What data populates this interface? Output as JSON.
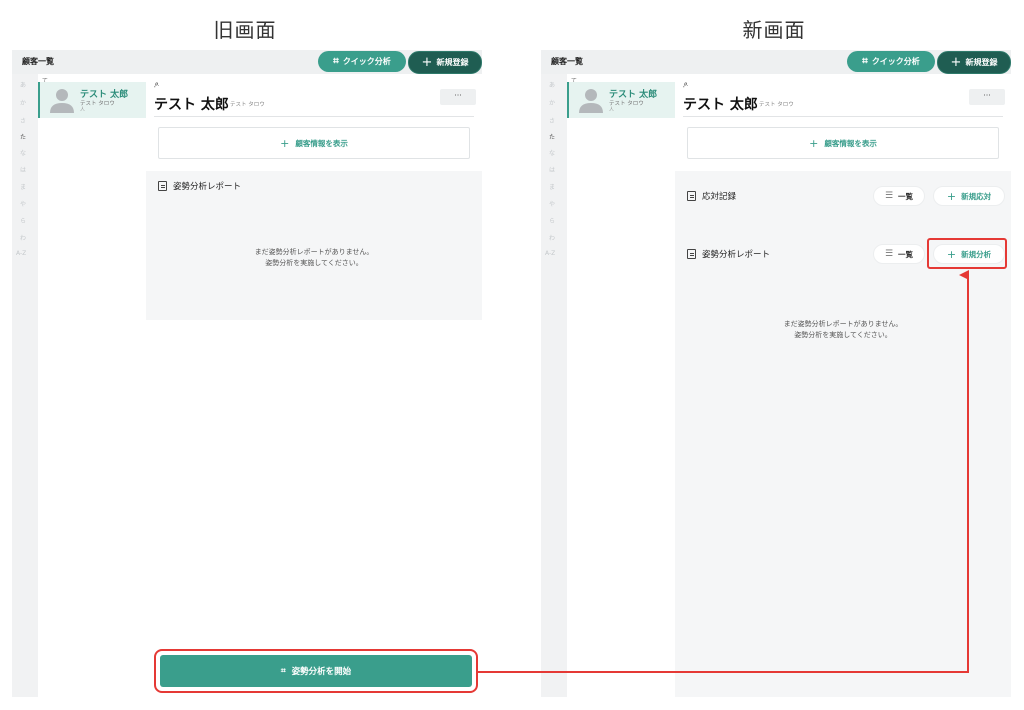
{
  "headings": {
    "old": "旧画面",
    "new": "新画面"
  },
  "common": {
    "title": "顧客一覧",
    "quick_analysis": "クイック分析",
    "new_registration": "新規登録",
    "kana_index": [
      "あ",
      "か",
      "さ",
      "た",
      "な",
      "は",
      "ま",
      "や",
      "ら",
      "わ",
      "A-Z"
    ],
    "active_kana": "た",
    "group_head": "て",
    "customer": {
      "name": "テスト 太郎",
      "kana": "テスト タロウ",
      "mini": "人"
    },
    "detail_name": "テスト 太郎",
    "detail_kana": "テスト タロウ",
    "more": "···",
    "show_info": "顧客情報を表示",
    "empty_line1": "まだ姿勢分析レポートがありません。",
    "empty_line2": "姿勢分析を実施してください。"
  },
  "old_screen": {
    "report_title": "姿勢分析レポート",
    "start_button": "姿勢分析を開始"
  },
  "new_screen": {
    "record_title": "応対記録",
    "report_title": "姿勢分析レポート",
    "list_label": "一覧",
    "new_response": "新規応対",
    "new_analysis": "新規分析"
  },
  "colors": {
    "accent": "#3a9e8c",
    "dark_accent": "#1f5d52",
    "highlight": "#e53935"
  }
}
